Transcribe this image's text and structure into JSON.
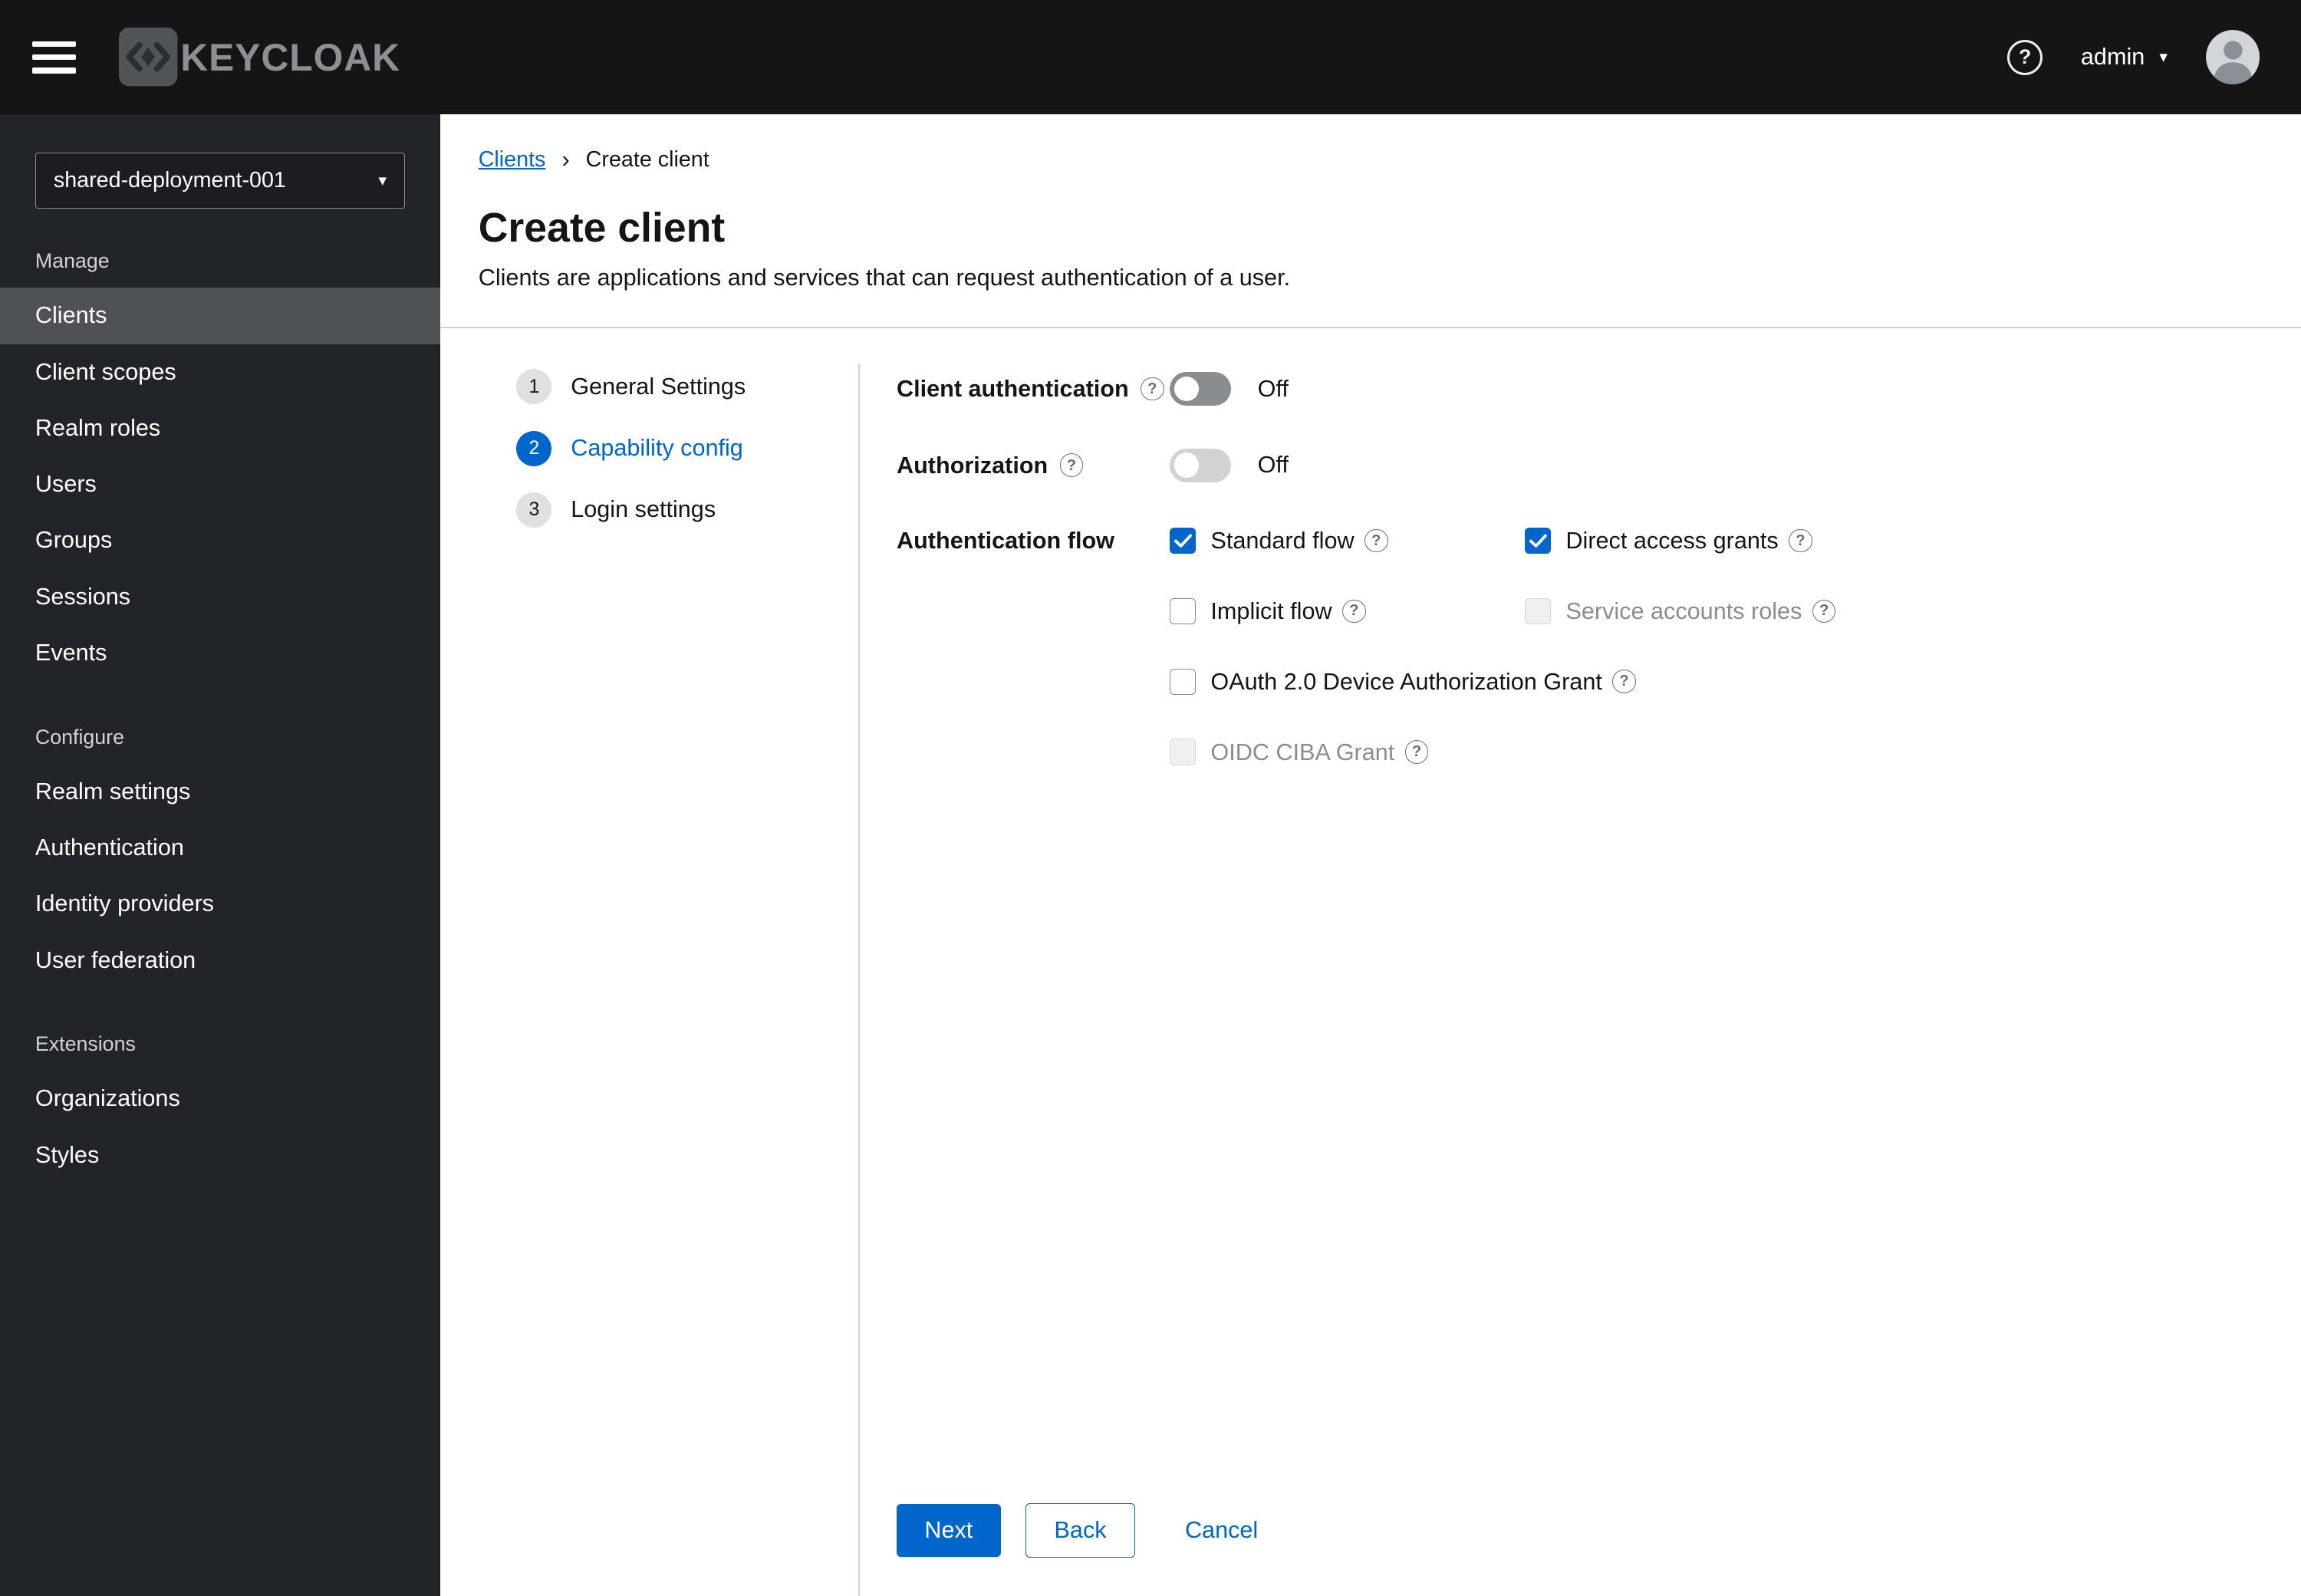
{
  "topbar": {
    "brand": "KEYCLOAK",
    "user": "admin"
  },
  "icons": {
    "help": "?",
    "caret_down": "▾",
    "breadcrumb_separator": "›"
  },
  "colors": {
    "primary_blue": "#0066cc",
    "masthead_black": "#151515",
    "sidebar_dark": "#212428",
    "nav_active_gray": "#4f5255"
  },
  "sidebar": {
    "realm_selector": {
      "value": "shared-deployment-001"
    },
    "sections": [
      {
        "label": "Manage",
        "items": [
          {
            "label": "Clients",
            "active": true
          },
          {
            "label": "Client scopes",
            "active": false
          },
          {
            "label": "Realm roles",
            "active": false
          },
          {
            "label": "Users",
            "active": false
          },
          {
            "label": "Groups",
            "active": false
          },
          {
            "label": "Sessions",
            "active": false
          },
          {
            "label": "Events",
            "active": false
          }
        ]
      },
      {
        "label": "Configure",
        "items": [
          {
            "label": "Realm settings",
            "active": false
          },
          {
            "label": "Authentication",
            "active": false
          },
          {
            "label": "Identity providers",
            "active": false
          },
          {
            "label": "User federation",
            "active": false
          }
        ]
      },
      {
        "label": "Extensions",
        "items": [
          {
            "label": "Organizations",
            "active": false
          },
          {
            "label": "Styles",
            "active": false
          }
        ]
      }
    ]
  },
  "breadcrumb": {
    "link": "Clients",
    "current": "Create client"
  },
  "page": {
    "title": "Create client",
    "subtitle": "Clients are applications and services that can request authentication of a user."
  },
  "wizard": {
    "steps": [
      {
        "num": "1",
        "label": "General Settings",
        "state": "default"
      },
      {
        "num": "2",
        "label": "Capability config",
        "state": "current"
      },
      {
        "num": "3",
        "label": "Login settings",
        "state": "default"
      }
    ]
  },
  "form": {
    "client_authentication": {
      "label": "Client authentication",
      "state": "Off",
      "enabled": true
    },
    "authorization": {
      "label": "Authorization",
      "state": "Off",
      "enabled": false
    },
    "authentication_flow": {
      "label": "Authentication flow",
      "options": [
        {
          "label": "Standard flow",
          "checked": true,
          "disabled": false
        },
        {
          "label": "Direct access grants",
          "checked": true,
          "disabled": false
        },
        {
          "label": "Implicit flow",
          "checked": false,
          "disabled": false
        },
        {
          "label": "Service accounts roles",
          "checked": false,
          "disabled": true
        },
        {
          "label": "OAuth 2.0 Device Authorization Grant",
          "checked": false,
          "disabled": false
        },
        {
          "label": "OIDC CIBA Grant",
          "checked": false,
          "disabled": true
        }
      ]
    },
    "actions": {
      "next": "Next",
      "back": "Back",
      "cancel": "Cancel"
    }
  }
}
